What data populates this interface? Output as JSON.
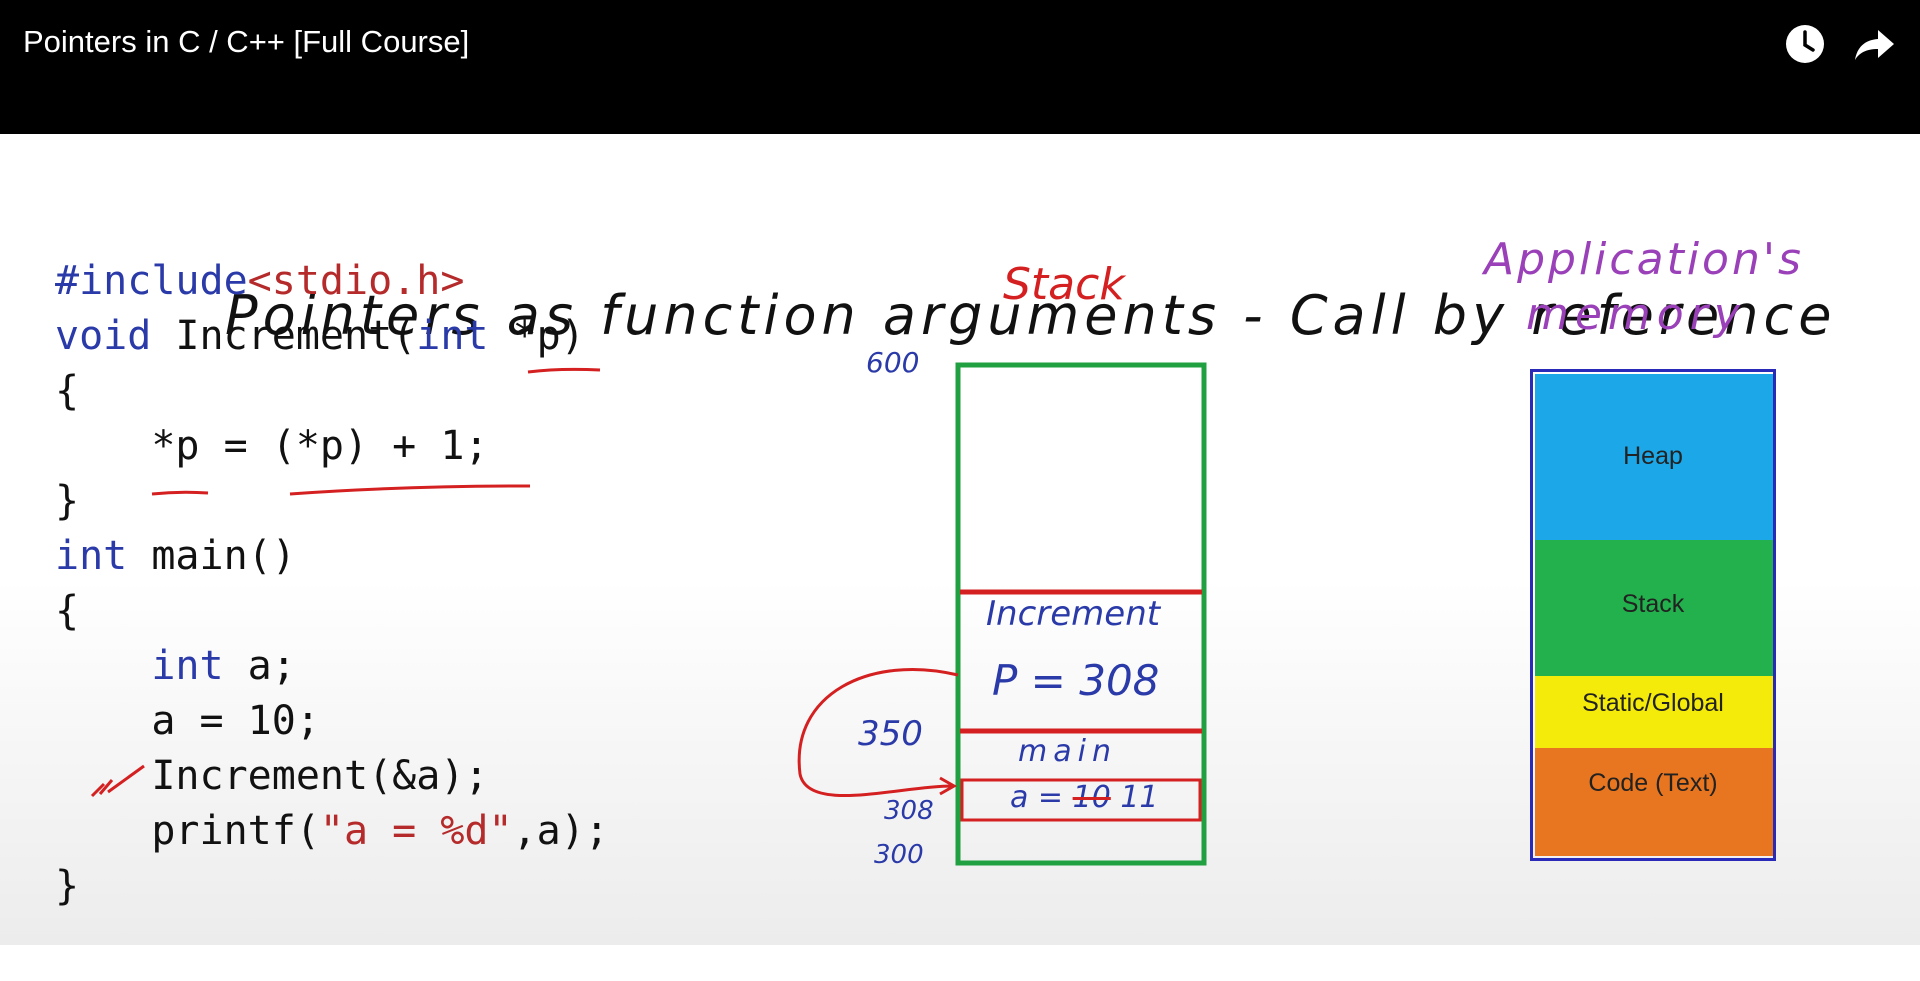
{
  "header": {
    "title": "Pointers in C / C++ [Full Course]",
    "watch_later_icon": "clock-icon",
    "share_icon": "share-arrow-icon"
  },
  "slide": {
    "title": "Pointers as function arguments - Call by reference",
    "code": {
      "include_directive": "#include",
      "include_header": "<stdio.h>",
      "void_kw": "void",
      "increment_sig": " Increment(",
      "int_kw": "int",
      "param": " *p)",
      "brace_open_1": "{",
      "deref_stmt": "    *p = (*p) + 1;",
      "brace_close_1": "}",
      "int_kw_2": "int",
      "main_sig": " main()",
      "brace_open_2": "{",
      "int_kw_3": "    int",
      "decl_a": " a;",
      "assign_a": "    a = 10;",
      "call_increment": "    Increment(&a);",
      "printf_start": "    printf(",
      "printf_str": "\"a = %d\"",
      "printf_end": ",a);",
      "brace_close_2": "}"
    },
    "stack_diagram": {
      "title": "Stack",
      "addr_top": "600",
      "addr_350": "350",
      "addr_308": "308",
      "addr_300": "300",
      "frame_increment_label": "Increment",
      "frame_increment_var": "P = 308",
      "frame_main_label": "main",
      "frame_main_var_prefix": "a =",
      "frame_main_old_value": "10",
      "frame_main_new_value": "11"
    },
    "memory_diagram": {
      "title_line1": "Application's",
      "title_line2": "memory",
      "segments": [
        {
          "label": "Heap",
          "color": "#1ca8e8"
        },
        {
          "label": "Stack",
          "color": "#22b14c"
        },
        {
          "label": "Static/Global",
          "color": "#f5eb0a"
        },
        {
          "label": "Code (Text)",
          "color": "#e8751f"
        }
      ],
      "border_color": "#2a2ab8"
    }
  }
}
